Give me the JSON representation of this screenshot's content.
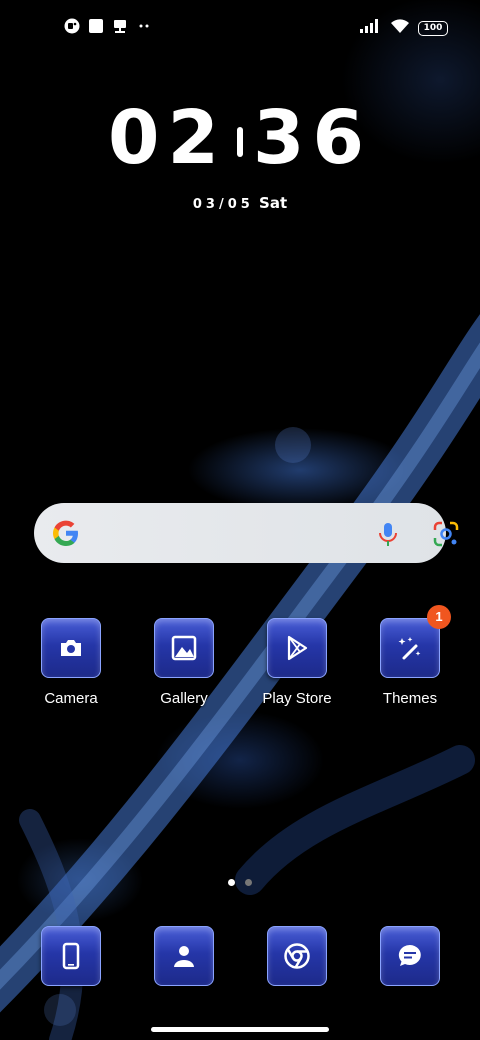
{
  "status_bar": {
    "left_icons": [
      "video-call-icon",
      "square-notification-icon",
      "screenshot-icon",
      "more-dots-icon"
    ],
    "right_icons": [
      "signal-icon",
      "wifi-icon",
      "battery-icon"
    ],
    "battery_level": "100"
  },
  "clock": {
    "hours": "02",
    "minutes": "36",
    "date": "03/05",
    "weekday": "Sat"
  },
  "search": {
    "icons": [
      "google-logo-icon",
      "microphone-icon",
      "google-lens-icon"
    ]
  },
  "apps": [
    {
      "label": "Camera",
      "icon": "camera-icon"
    },
    {
      "label": "Gallery",
      "icon": "gallery-icon"
    },
    {
      "label": "Play Store",
      "icon": "play-store-icon"
    },
    {
      "label": "Themes",
      "icon": "themes-icon",
      "badge": "1"
    }
  ],
  "dock": [
    {
      "icon": "phone-icon"
    },
    {
      "icon": "contacts-icon"
    },
    {
      "icon": "chrome-icon"
    },
    {
      "icon": "messages-icon"
    }
  ],
  "pager": {
    "current": 1,
    "total": 2
  },
  "colors": {
    "tile_top": "#4a5fd8",
    "tile_bottom": "#1d2a8a",
    "badge": "#f0561f",
    "search_bg": "#e9ebee"
  }
}
